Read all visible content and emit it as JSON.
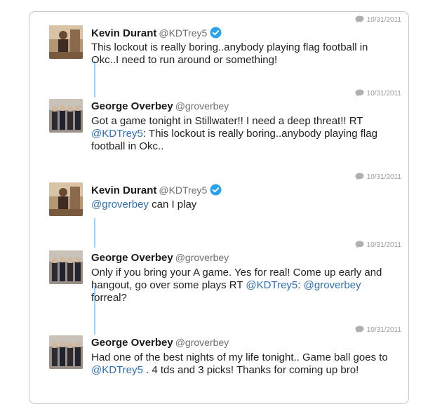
{
  "tweets": [
    {
      "name": "Kevin Durant",
      "handle": "@KDTrey5",
      "verified": true,
      "timestamp": "10/31/2011",
      "text_parts": [
        {
          "t": "This lockout is really boring..anybody playing flag football in Okc..I need to run around or something!",
          "mention": false
        }
      ]
    },
    {
      "name": "George Overbey",
      "handle": "@groverbey",
      "verified": false,
      "timestamp": "10/31/2011",
      "text_parts": [
        {
          "t": "Got a game tonight in Stillwater!! I need a deep threat!! RT ",
          "mention": false
        },
        {
          "t": "@KDTrey5",
          "mention": true
        },
        {
          "t": ": This lockout is really boring..anybody playing flag football in Okc..",
          "mention": false
        }
      ]
    },
    {
      "name": "Kevin Durant",
      "handle": "@KDTrey5",
      "verified": true,
      "timestamp": "10/31/2011",
      "text_parts": [
        {
          "t": "@groverbey",
          "mention": true
        },
        {
          "t": " can I play",
          "mention": false
        }
      ]
    },
    {
      "name": "George Overbey",
      "handle": "@groverbey",
      "verified": false,
      "timestamp": "10/31/2011",
      "text_parts": [
        {
          "t": "Only if you bring your A game. Yes for real! Come up early and hangout, go over some plays RT ",
          "mention": false
        },
        {
          "t": "@KDTrey5",
          "mention": true
        },
        {
          "t": ": ",
          "mention": false
        },
        {
          "t": "@groverbey",
          "mention": true
        },
        {
          "t": " forreal?",
          "mention": false
        }
      ]
    },
    {
      "name": "George Overbey",
      "handle": "@groverbey",
      "verified": false,
      "timestamp": "10/31/2011",
      "text_parts": [
        {
          "t": "Had one of the best nights of my life tonight.. Game ball goes to ",
          "mention": false
        },
        {
          "t": "@KDTrey5",
          "mention": true
        },
        {
          "t": " . 4 tds and 3 picks! Thanks for coming up bro!",
          "mention": false
        }
      ]
    }
  ],
  "colors": {
    "mention": "#2f6fb3",
    "verified": "#2aa3ef",
    "thread_line": "#9fd3ef"
  }
}
